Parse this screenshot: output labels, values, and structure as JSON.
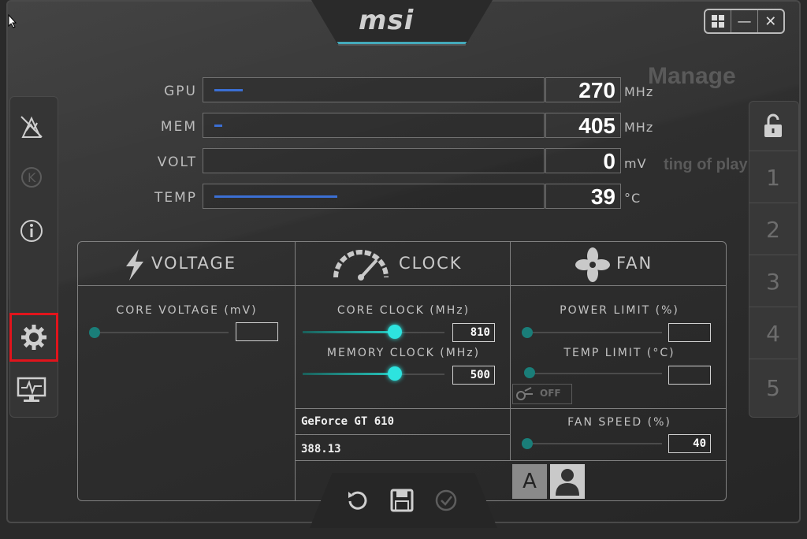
{
  "app": {
    "logo": "msi"
  },
  "window_controls": {
    "windows_icon": "windows-icon",
    "minimize": "—",
    "close": "✕"
  },
  "background_text": {
    "line1": "Manage",
    "line2": "ting of play"
  },
  "left_sidebar": [
    {
      "name": "oc-scanner-icon"
    },
    {
      "name": "kombustor-icon"
    },
    {
      "name": "info-icon"
    },
    {
      "name": "settings-icon",
      "selected": true
    },
    {
      "name": "monitor-icon"
    }
  ],
  "profiles": {
    "lock_icon": "unlock-icon",
    "slots": [
      "1",
      "2",
      "3",
      "4",
      "5"
    ]
  },
  "metrics": [
    {
      "label": "GPU",
      "value": "270",
      "unit": "MHz"
    },
    {
      "label": "MEM",
      "value": "405",
      "unit": "MHz"
    },
    {
      "label": "VOLT",
      "value": "0",
      "unit": "mV"
    },
    {
      "label": "TEMP",
      "value": "39",
      "unit": "°C"
    }
  ],
  "voltage": {
    "title": "VOLTAGE",
    "core_voltage_label": "CORE VOLTAGE (mV)",
    "core_voltage_value": ""
  },
  "clock": {
    "title": "CLOCK",
    "core_clock_label": "CORE CLOCK (MHz)",
    "core_clock_value": "810",
    "memory_clock_label": "MEMORY CLOCK (MHz)",
    "memory_clock_value": "500"
  },
  "fan": {
    "title": "FAN",
    "power_limit_label": "POWER LIMIT (%)",
    "power_limit_value": "",
    "temp_limit_label": "TEMP LIMIT (°C)",
    "temp_limit_value": "",
    "link_toggle": "OFF",
    "fan_speed_label": "FAN SPEED (%)",
    "fan_speed_value": "40",
    "mode_auto": "A"
  },
  "gpu_info": {
    "name": "GeForce GT 610",
    "driver": "388.13"
  },
  "bottom_actions": [
    "reset-icon",
    "save-icon",
    "apply-icon"
  ],
  "colors": {
    "accent": "#2de3df",
    "highlight": "#e1141c",
    "bar_fill": "#3b6fd4"
  }
}
